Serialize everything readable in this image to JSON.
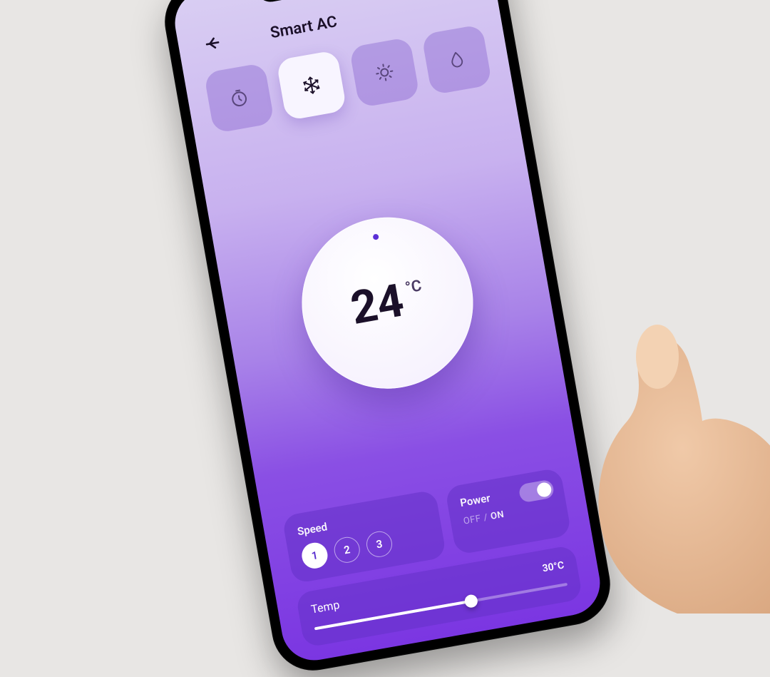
{
  "header": {
    "title": "Smart AC"
  },
  "modes": {
    "items": [
      {
        "name": "timer-icon"
      },
      {
        "name": "snowflake-icon"
      },
      {
        "name": "sun-icon"
      },
      {
        "name": "droplet-icon"
      }
    ]
  },
  "dial": {
    "value": "24",
    "unit": "°C"
  },
  "speed": {
    "label": "Speed",
    "options": [
      "1",
      "2",
      "3"
    ],
    "selected": "1"
  },
  "power": {
    "label": "Power",
    "off_label": "OFF",
    "on_label": "ON",
    "state": "on"
  },
  "temp_slider": {
    "label": "Temp",
    "max_label": "30°C"
  },
  "colors": {
    "accent": "#6c2fe0"
  }
}
